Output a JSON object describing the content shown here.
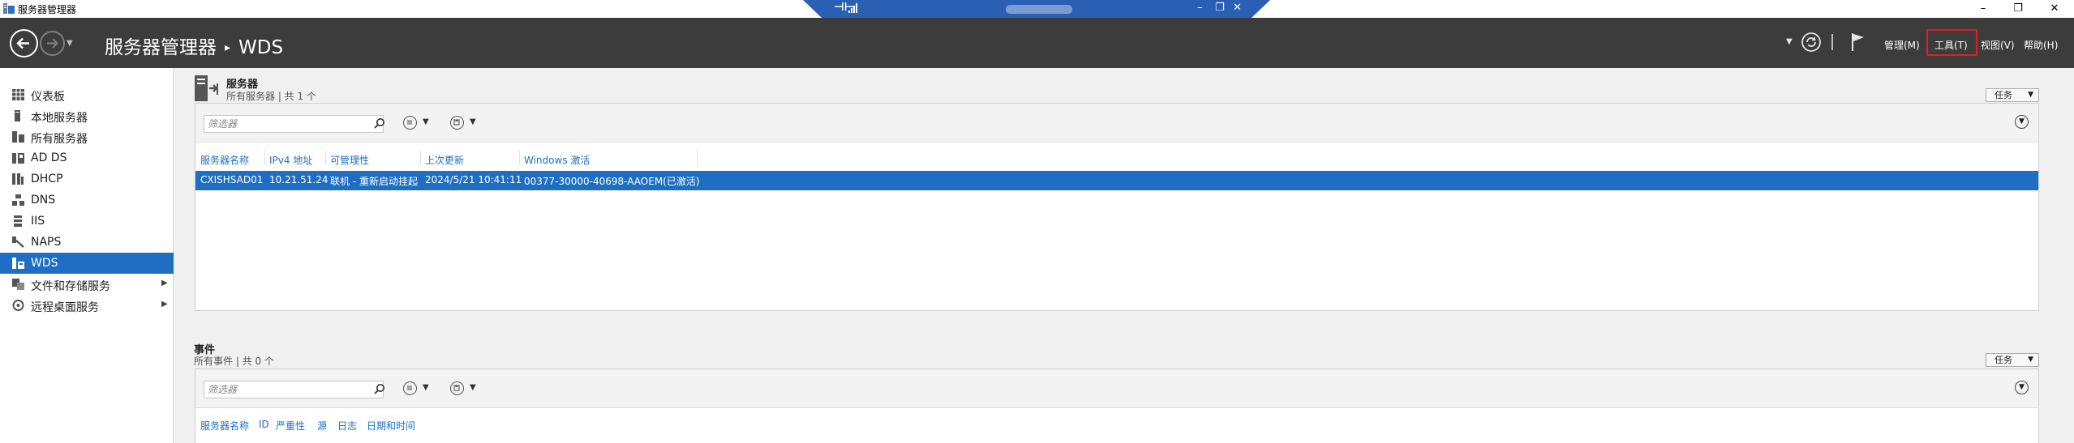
{
  "window": {
    "title": "服务器管理器",
    "controls": {
      "minimize": "–",
      "restore": "❐",
      "close": "✕"
    }
  },
  "remote_bar": {
    "pin_icon": "pin-icon",
    "signal_icon": "signal-icon",
    "controls": {
      "minimize": "–",
      "restore": "❐",
      "close": "✕"
    }
  },
  "header": {
    "breadcrumb_root": "服务器管理器",
    "breadcrumb_separator": "▸",
    "breadcrumb_current": "WDS",
    "menus": {
      "manage": "管理(M)",
      "tools": "工具(T)",
      "view": "视图(V)",
      "help": "帮助(H)"
    }
  },
  "sidebar": {
    "items": [
      {
        "label": "仪表板",
        "icon": "dashboard-icon"
      },
      {
        "label": "本地服务器",
        "icon": "local-server-icon"
      },
      {
        "label": "所有服务器",
        "icon": "all-servers-icon"
      },
      {
        "label": "AD DS",
        "icon": "ad-ds-icon"
      },
      {
        "label": "DHCP",
        "icon": "dhcp-icon"
      },
      {
        "label": "DNS",
        "icon": "dns-icon"
      },
      {
        "label": "IIS",
        "icon": "iis-icon"
      },
      {
        "label": "NAPS",
        "icon": "naps-icon"
      },
      {
        "label": "WDS",
        "icon": "wds-icon",
        "active": true
      },
      {
        "label": "文件和存储服务",
        "icon": "file-storage-icon",
        "has_children": true
      },
      {
        "label": "远程桌面服务",
        "icon": "remote-desktop-icon",
        "has_children": true
      }
    ],
    "expand_arrow": "▶"
  },
  "servers_tile": {
    "title": "服务器",
    "subtitle": "所有服务器 | 共 1 个",
    "tasks_label": "任务",
    "filter_placeholder": "筛选器",
    "columns": [
      "服务器名称",
      "IPv4 地址",
      "可管理性",
      "上次更新",
      "Windows 激活"
    ],
    "rows": [
      [
        "CXISHSAD01",
        "10.21.51.24",
        "联机 - 重新启动挂起",
        "2024/5/21 10:41:11",
        "00377-30000-40698-AAOEM(已激活)"
      ]
    ]
  },
  "events_tile": {
    "title": "事件",
    "subtitle": "所有事件 | 共 0 个",
    "tasks_label": "任务",
    "filter_placeholder": "筛选器",
    "columns": [
      "服务器名称",
      "ID",
      "严重性",
      "源",
      "日志",
      "日期和时间"
    ]
  },
  "colors": {
    "header_bg": "#3c3c3c",
    "accent": "#1e6fc3",
    "highlight_box": "#e02020",
    "remote_bar": "#2a5fb4"
  }
}
